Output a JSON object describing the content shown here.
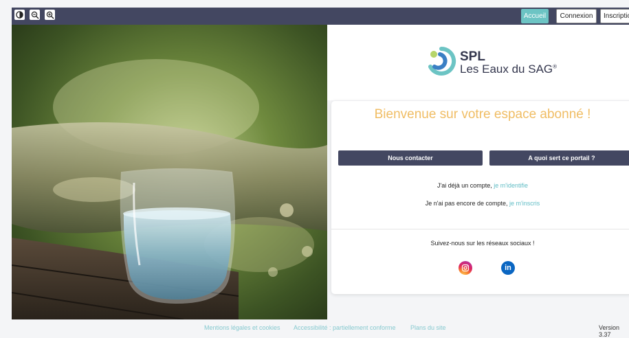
{
  "toolbar": {
    "contrast_icon": "contrast-icon",
    "zoom_out_icon": "zoom-out-icon",
    "zoom_in_icon": "zoom-in-icon"
  },
  "nav": {
    "accueil": "Accueil",
    "connexion": "Connexion",
    "inscription": "Inscriptio"
  },
  "brand": {
    "line1": "SPL",
    "line2": "Les Eaux du SAG",
    "mark": "®",
    "colors": {
      "teal": "#6cc4c4",
      "blue": "#3a7fc4",
      "lime": "#b6d56a"
    }
  },
  "welcome": {
    "title": "Bienvenue sur votre espace abonné !"
  },
  "actions": {
    "contact": "Nous contacter",
    "about": "A quoi sert ce portail ?"
  },
  "login_line": {
    "text": "J'ai déjà un compte, ",
    "link": "je m'identifie"
  },
  "signup_line": {
    "text": "Je n'ai pas encore de compte, ",
    "link": "je m'inscris"
  },
  "social": {
    "heading": "Suivez-nous sur les réseaux sociaux !",
    "instagram_icon": "instagram-icon",
    "linkedin_icon": "linkedin-icon"
  },
  "footer": {
    "mentions": "Mentions légales et cookies",
    "accessibility": "Accessibilité : partiellement conforme",
    "sitemap": "Plans du site",
    "version": "Version 3.37"
  },
  "colors": {
    "header": "#434761",
    "accent": "#6cc4c4",
    "welcome": "#f0bd64",
    "link": "#5fbcc4"
  }
}
